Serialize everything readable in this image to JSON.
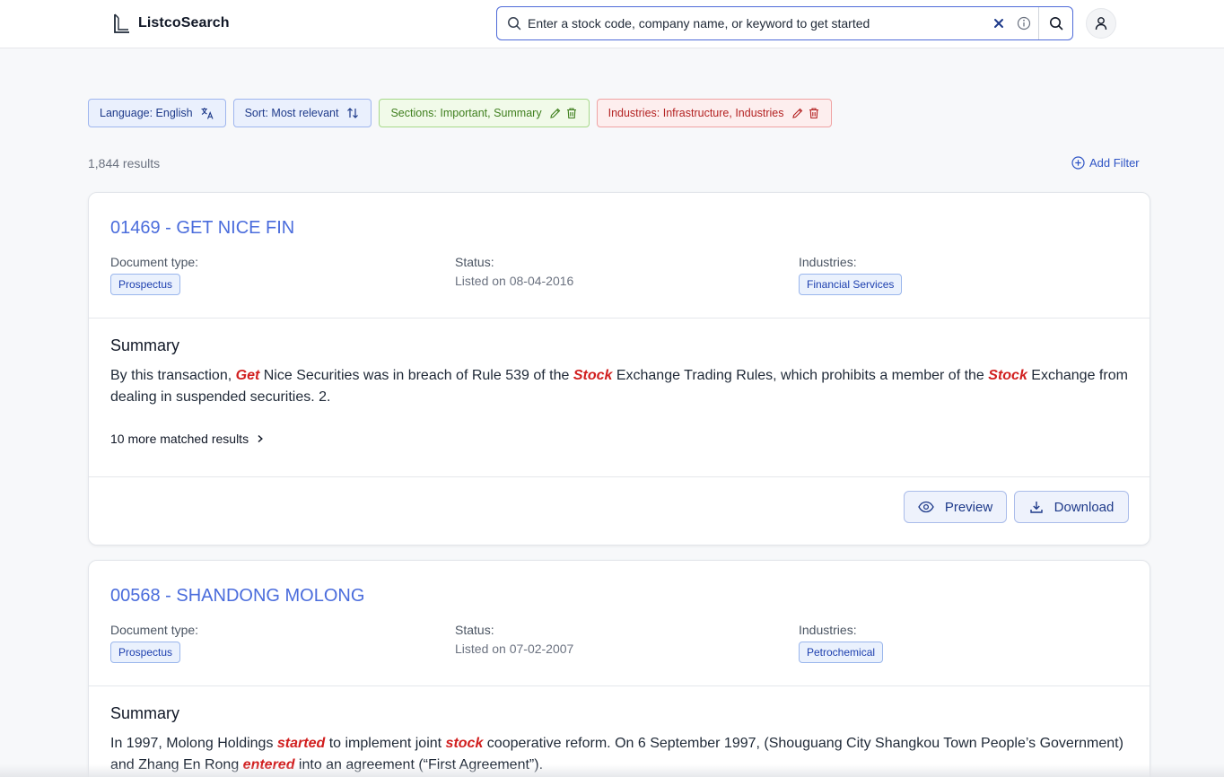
{
  "app": {
    "name": "ListcoSearch"
  },
  "search": {
    "placeholder": "Enter a stock code, company name, or keyword to get started",
    "clear_icon": "close-icon",
    "info_icon": "info-icon",
    "submit_icon": "search-icon"
  },
  "user": {
    "icon": "user-icon"
  },
  "filters": [
    {
      "label": "Language: English",
      "color": "blue",
      "icons": [
        "translate-icon"
      ]
    },
    {
      "label": "Sort: Most relevant",
      "color": "blue",
      "icons": [
        "sort-arrows-icon"
      ]
    },
    {
      "label": "Sections: Important, Summary",
      "color": "green",
      "icons": [
        "edit-icon",
        "trash-icon"
      ]
    },
    {
      "label": "Industries: Infrastructure, Industries",
      "color": "red",
      "icons": [
        "edit-icon",
        "trash-icon"
      ]
    }
  ],
  "results": {
    "count_text": "1,844 results",
    "add_filter_label": "Add Filter"
  },
  "labels": {
    "document_type": "Document type:",
    "status": "Status:",
    "industries": "Industries:",
    "summary": "Summary",
    "preview": "Preview",
    "download": "Download"
  },
  "colors": {
    "accent": "#4a6cdc",
    "highlight": "#d11f1f",
    "filter_blue": "#eaf0fd",
    "filter_green": "#f1fae9",
    "filter_red": "#fdeeee"
  },
  "cards": [
    {
      "title": "01469 - GET NICE FIN",
      "document_type": "Prospectus",
      "status": "Listed on 08-04-2016",
      "industry": "Financial Services",
      "summary_segments": [
        {
          "text": "By this transaction, ",
          "hl": false
        },
        {
          "text": "Get",
          "hl": true
        },
        {
          "text": " Nice Securities was in breach of Rule 539 of the ",
          "hl": false
        },
        {
          "text": "Stock",
          "hl": true
        },
        {
          "text": " Exchange Trading Rules, which prohibits a member of the ",
          "hl": false
        },
        {
          "text": "Stock",
          "hl": true
        },
        {
          "text": " Exchange from dealing in suspended securities. 2.",
          "hl": false
        }
      ],
      "more_results": "10 more matched results"
    },
    {
      "title": "00568 - SHANDONG MOLONG",
      "document_type": "Prospectus",
      "status": "Listed on 07-02-2007",
      "industry": "Petrochemical",
      "summary_segments": [
        {
          "text": "In 1997, Molong Holdings ",
          "hl": false
        },
        {
          "text": "started",
          "hl": true
        },
        {
          "text": " to implement joint ",
          "hl": false
        },
        {
          "text": "stock",
          "hl": true
        },
        {
          "text": " cooperative reform. On 6 September 1997, (Shouguang City Shangkou Town People’s Government) and Zhang En Rong ",
          "hl": false
        },
        {
          "text": "entered",
          "hl": true
        },
        {
          "text": " into an agreement (“First Agreement”).",
          "hl": false
        }
      ]
    }
  ]
}
